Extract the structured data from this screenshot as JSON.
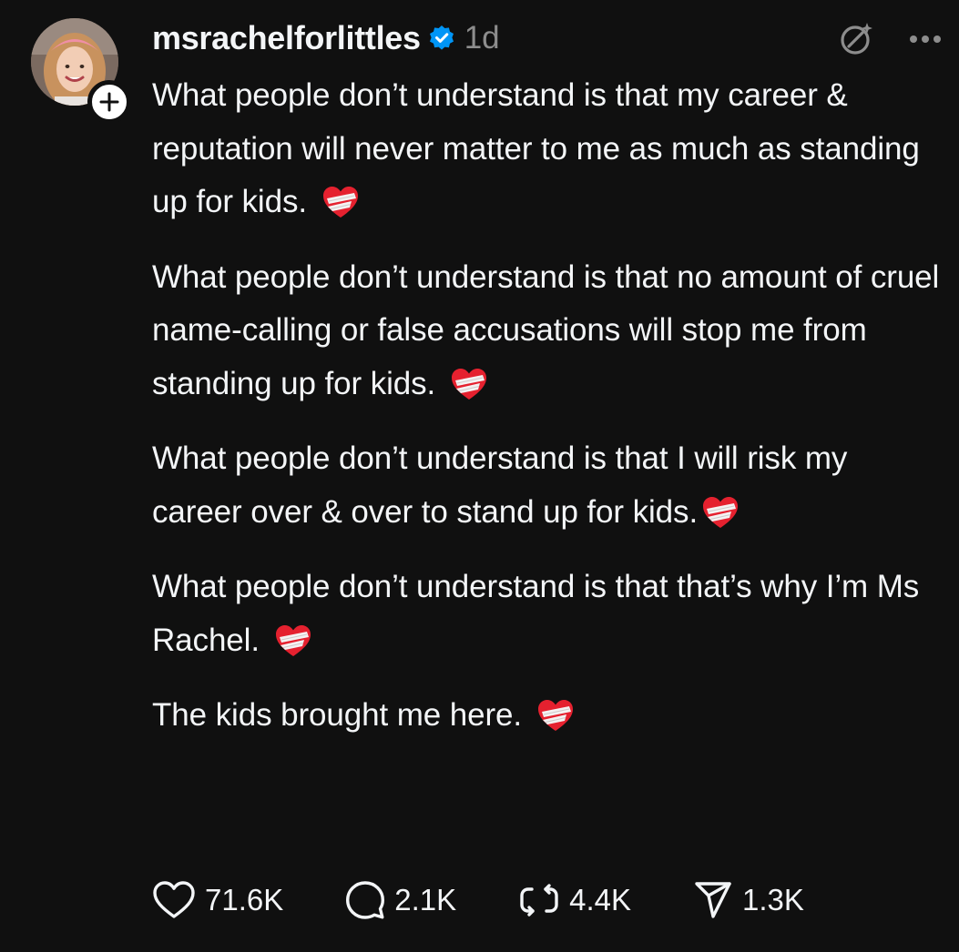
{
  "post": {
    "username": "msrachelforlittles",
    "timestamp": "1d",
    "paragraphs": [
      "What people don’t understand is that my career & reputation will never matter to me as much as standing up for kids.",
      "What people don’t understand is that no amount of cruel name-calling or false accusations will stop me from standing up for kids.",
      "What people don’t understand is that I will risk my career over & over to stand up for kids.",
      "What people don’t understand is that that’s why I’m Ms Rachel.",
      "The kids brought me here."
    ],
    "emoji": "mending-heart"
  },
  "actions": {
    "likes": "71.6K",
    "comments": "2.1K",
    "reposts": "4.4K",
    "shares": "1.3K"
  },
  "icons": {
    "verified": "verified-badge-icon",
    "follow": "plus-icon",
    "ai": "ai-sparkle-icon",
    "more": "more-dots-icon",
    "like": "heart-outline-icon",
    "comment": "comment-bubble-icon",
    "repost": "repost-icon",
    "share": "share-paper-plane-icon"
  },
  "colors": {
    "background": "#101010",
    "text": "#f3f5f7",
    "muted": "#8d8d8d",
    "verified": "#0095f6",
    "heart_red": "#e5212f"
  }
}
